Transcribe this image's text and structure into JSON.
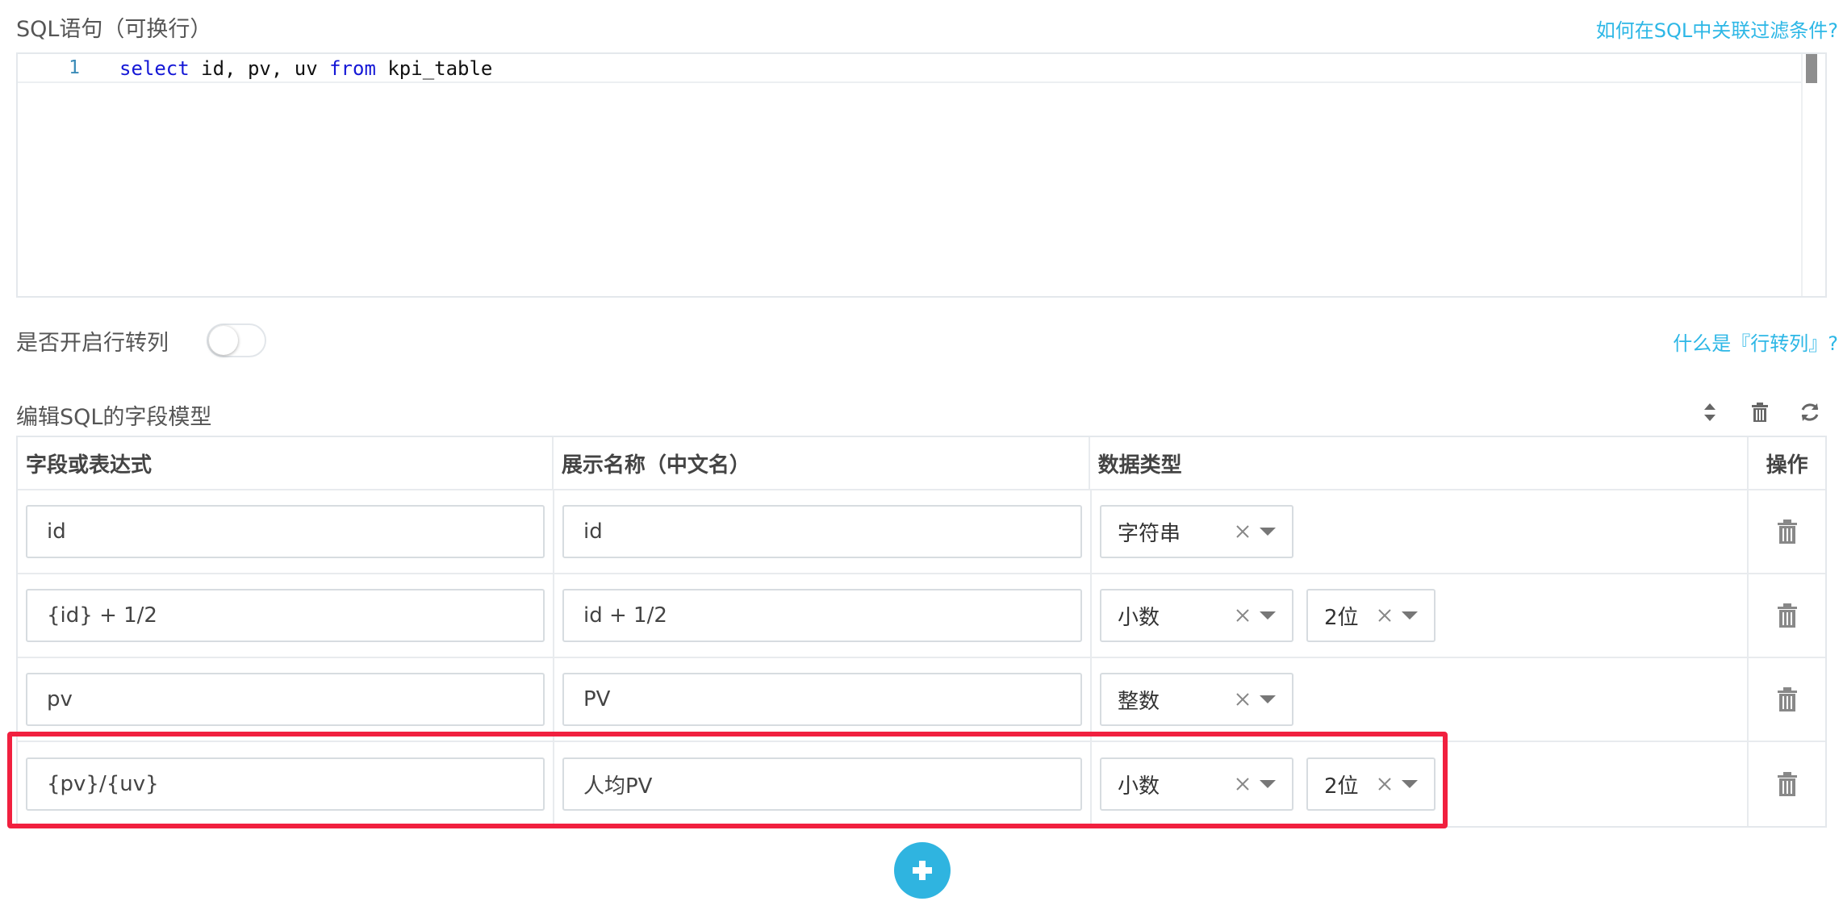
{
  "sql": {
    "label": "SQL语句（可换行）",
    "help_link": "如何在SQL中关联过滤条件?",
    "line_number": "1",
    "code_tokens": [
      {
        "text": "select",
        "kind": "keyword"
      },
      {
        "text": " id, pv, uv ",
        "kind": "plain"
      },
      {
        "text": "from",
        "kind": "keyword"
      },
      {
        "text": " kpi_table",
        "kind": "plain"
      }
    ]
  },
  "pivot": {
    "label": "是否开启行转列",
    "help_link": "什么是『行转列』?",
    "enabled": false
  },
  "fields": {
    "label": "编辑SQL的字段模型",
    "toolbar_icons": [
      "sort-icon",
      "trash-icon",
      "refresh-icon"
    ],
    "headers": {
      "expr": "字段或表达式",
      "display": "展示名称（中文名）",
      "type": "数据类型",
      "action": "操作"
    },
    "rows": [
      {
        "expr": "id",
        "display": "id",
        "type": "字符串",
        "precision": null
      },
      {
        "expr": "{id} + 1/2",
        "display": "id + 1/2",
        "type": "小数",
        "precision": "2位"
      },
      {
        "expr": "pv",
        "display": "PV",
        "type": "整数",
        "precision": null
      },
      {
        "expr": "{pv}/{uv}",
        "display": "人均PV",
        "type": "小数",
        "precision": "2位"
      }
    ],
    "highlighted_row": 3
  },
  "colors": {
    "accent": "#2fb4e0",
    "keyword": "#1518d6",
    "highlight": "#f1203f"
  }
}
